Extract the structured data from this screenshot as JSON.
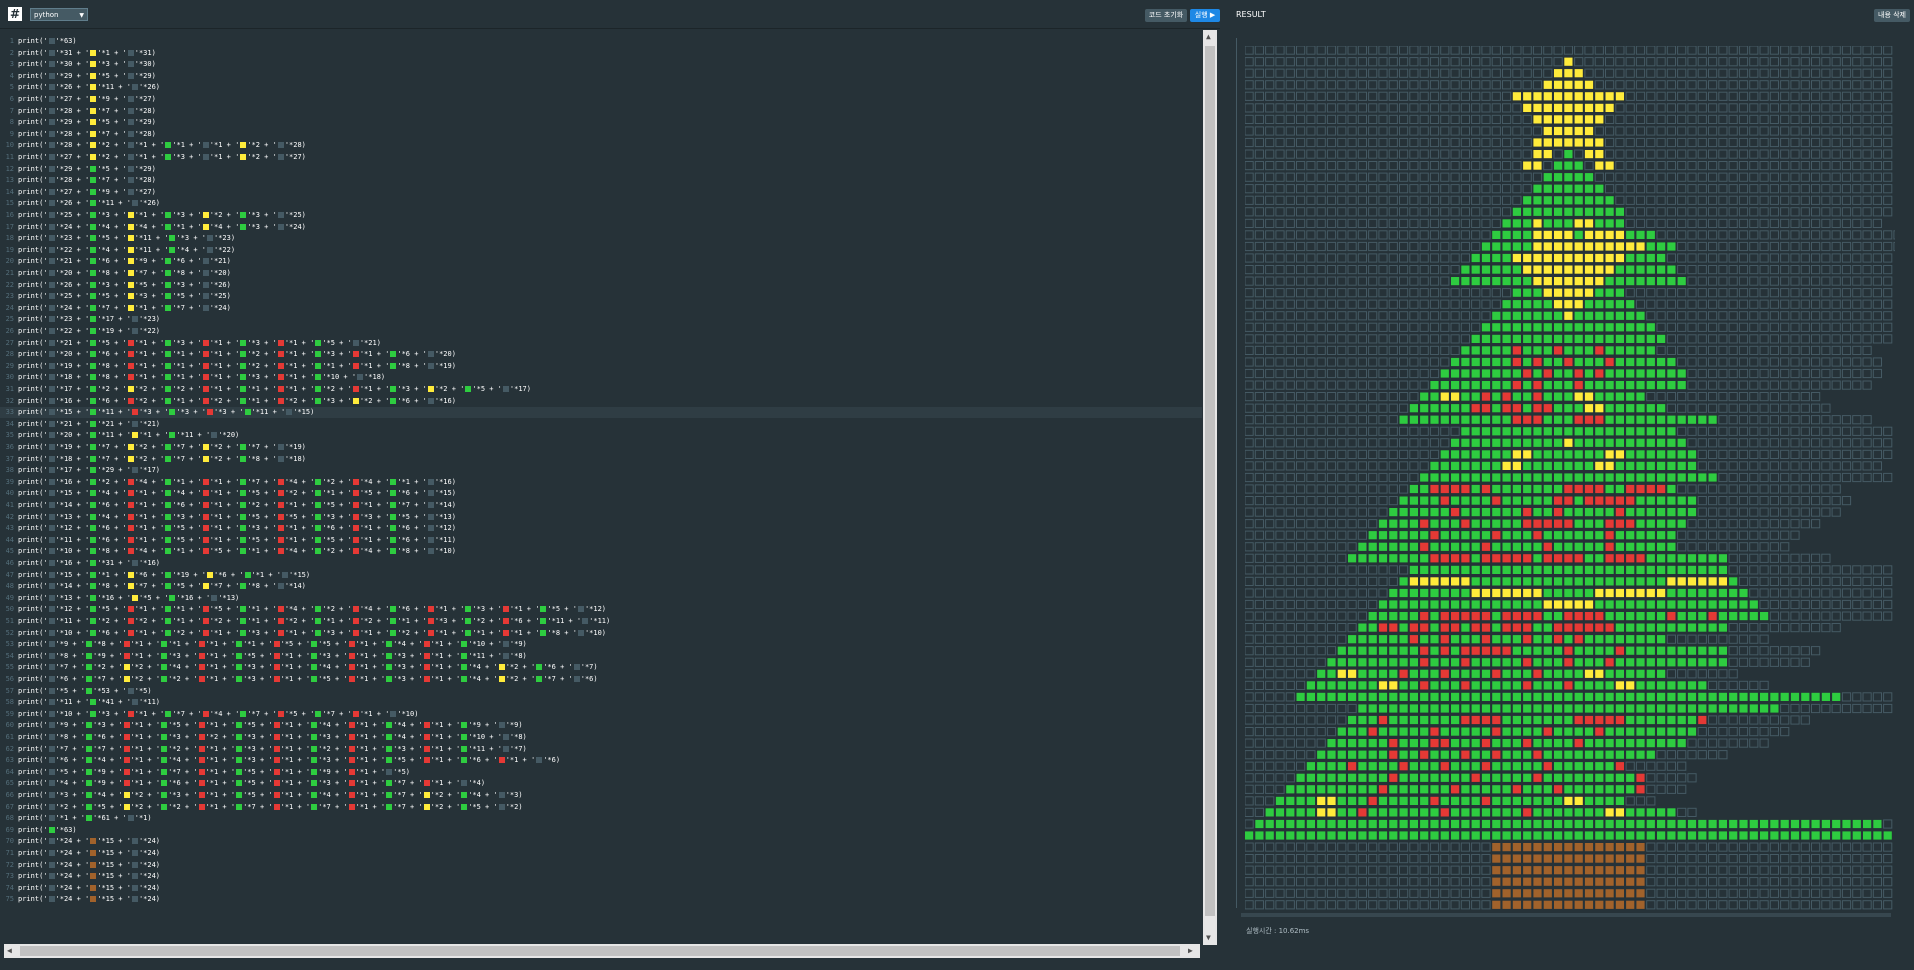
{
  "toolbar": {
    "logo_icon": "#",
    "language": "python",
    "reset_label": "코드 초기화",
    "run_label": "실행 ▶"
  },
  "result": {
    "title": "RESULT",
    "clear_label": "내용 삭제",
    "exec_time": "실행시간 : 10.62ms"
  },
  "colors": {
    "black": "#455a64",
    "yellow": "#ffeb3b",
    "green": "#2ecc40",
    "red": "#e53935",
    "brown": "#a1622b"
  },
  "code_lines": [
    "print('⬛'*63)",
    "print('⬛'*31 + '🟨'*1 + '⬛'*31)",
    "print('⬛'*30 + '🟨'*3 + '⬛'*30)",
    "print('⬛'*29 + '🟨'*5 + '⬛'*29)",
    "print('⬛'*26 + '🟨'*11 + '⬛'*26)",
    "print('⬛'*27 + '🟨'*9 + '⬛'*27)",
    "print('⬛'*28 + '🟨'*7 + '⬛'*28)",
    "print('⬛'*29 + '🟨'*5 + '⬛'*29)",
    "print('⬛'*28 + '🟨'*7 + '⬛'*28)",
    "print('⬛'*28 + '🟨'*2 + '⬛'*1 + '🟩'*1 + '⬛'*1 + '🟨'*2 + '⬛'*28)",
    "print('⬛'*27 + '🟨'*2 + '⬛'*1 + '🟩'*3 + '⬛'*1 + '🟨'*2 + '⬛'*27)",
    "print('⬛'*29 + '🟩'*5 + '⬛'*29)",
    "print('⬛'*28 + '🟩'*7 + '⬛'*28)",
    "print('⬛'*27 + '🟩'*9 + '⬛'*27)",
    "print('⬛'*26 + '🟩'*11 + '⬛'*26)",
    "print('⬛'*25 + '🟩'*3 + '🟨'*1 + '🟩'*3 + '🟨'*2 + '🟩'*3 + '⬛'*25)",
    "print('⬛'*24 + '🟩'*4 + '🟨'*4 + '🟩'*1 + '🟨'*4 + '🟩'*3 + '⬛'*24)",
    "print('⬛'*23 + '🟩'*5 + '🟨'*11 + '🟩'*3 + '⬛'*23)",
    "print('⬛'*22 + '🟩'*4 + '🟨'*11 + '🟩'*4 + '⬛'*22)",
    "print('⬛'*21 + '🟩'*6 + '🟨'*9 + '🟩'*6 + '⬛'*21)",
    "print('⬛'*20 + '🟩'*8 + '🟨'*7 + '🟩'*8 + '⬛'*20)",
    "print('⬛'*26 + '🟩'*3 + '🟨'*5 + '🟩'*3 + '⬛'*26)",
    "print('⬛'*25 + '🟩'*5 + '🟨'*3 + '🟩'*5 + '⬛'*25)",
    "print('⬛'*24 + '🟩'*7 + '🟨'*1 + '🟩'*7 + '⬛'*24)",
    "print('⬛'*23 + '🟩'*17 + '⬛'*23)",
    "print('⬛'*22 + '🟩'*19 + '⬛'*22)",
    "print('⬛'*21 + '🟩'*5 + '🟥'*1 + '🟩'*3 + '🟥'*1 + '🟩'*3 + '🟥'*1 + '🟩'*5 + '⬛'*21)",
    "print('⬛'*20 + '🟩'*6 + '🟥'*1 + '🟩'*1 + '🟥'*1 + '🟩'*2 + '🟥'*1 + '🟩'*3 + '🟥'*1 + '🟩'*6 + '⬛'*20)",
    "print('⬛'*19 + '🟩'*8 + '🟥'*1 + '🟩'*1 + '🟥'*1 + '🟩'*2 + '🟥'*1 + '🟩'*1 + '🟥'*1 + '🟩'*8 + '⬛'*19)",
    "print('⬛'*18 + '🟩'*8 + '🟥'*1 + '🟩'*1 + '🟥'*1 + '🟩'*3 + '🟥'*1 + '🟩'*10 + '⬛'*18)",
    "print('⬛'*17 + '🟩'*2 + '🟨'*2 + '🟩'*2 + '🟥'*1 + '🟩'*1 + '🟥'*1 + '🟩'*2 + '🟥'*1 + '🟩'*3 + '🟨'*2 + '🟩'*5 + '⬛'*17)",
    "print('⬛'*16 + '🟩'*6 + '🟥'*2 + '🟩'*1 + '🟥'*2 + '🟩'*1 + '🟥'*2 + '🟩'*3 + '🟨'*2 + '🟩'*6 + '⬛'*16)",
    "print('⬛'*15 + '🟩'*11 + '🟥'*3 + '🟩'*3 + '🟥'*3 + '🟩'*11 + '⬛'*15)",
    "print('⬛'*21 + '🟩'*21 + '⬛'*21)",
    "print('⬛'*20 + '🟩'*11 + '🟨'*1 + '🟩'*11 + '⬛'*20)",
    "print('⬛'*19 + '🟩'*7 + '🟨'*2 + '🟩'*7 + '🟨'*2 + '🟩'*7 + '⬛'*19)",
    "print('⬛'*18 + '🟩'*7 + '🟨'*2 + '🟩'*7 + '🟨'*2 + '🟩'*8 + '⬛'*18)",
    "print('⬛'*17 + '🟩'*29 + '⬛'*17)",
    "print('⬛'*16 + '🟩'*2 + '🟥'*4 + '🟩'*1 + '🟥'*1 + '🟩'*7 + '🟥'*4 + '🟩'*2 + '🟥'*4 + '🟩'*1 + '⬛'*16)",
    "print('⬛'*15 + '🟩'*4 + '🟥'*1 + '🟩'*4 + '🟥'*1 + '🟩'*5 + '🟥'*2 + '🟩'*1 + '🟥'*5 + '🟩'*6 + '⬛'*15)",
    "print('⬛'*14 + '🟩'*6 + '🟥'*1 + '🟩'*6 + '🟥'*1 + '🟩'*2 + '🟥'*1 + '🟩'*5 + '🟥'*1 + '🟩'*7 + '⬛'*14)",
    "print('⬛'*13 + '🟩'*4 + '🟥'*1 + '🟩'*3 + '🟥'*1 + '🟩'*5 + '🟥'*5 + '🟩'*3 + '🟥'*3 + '🟩'*5 + '⬛'*13)",
    "print('⬛'*12 + '🟩'*6 + '🟥'*1 + '🟩'*5 + '🟥'*1 + '🟩'*3 + '🟥'*1 + '🟩'*6 + '🟥'*1 + '🟩'*6 + '⬛'*12)",
    "print('⬛'*11 + '🟩'*6 + '🟥'*1 + '🟩'*5 + '🟥'*1 + '🟩'*5 + '🟥'*1 + '🟩'*5 + '🟥'*1 + '🟩'*6 + '⬛'*11)",
    "print('⬛'*10 + '🟩'*8 + '🟥'*4 + '🟩'*1 + '🟥'*5 + '🟩'*1 + '🟥'*4 + '🟩'*2 + '🟥'*4 + '🟩'*8 + '⬛'*10)",
    "print('⬛'*16 + '🟩'*31 + '⬛'*16)",
    "print('⬛'*15 + '🟩'*1 + '🟨'*6 + '🟩'*19 + '🟨'*6 + '🟩'*1 + '⬛'*15)",
    "print('⬛'*14 + '🟩'*8 + '🟨'*7 + '🟩'*5 + '🟨'*7 + '🟩'*8 + '⬛'*14)",
    "print('⬛'*13 + '🟩'*16 + '🟨'*5 + '🟩'*16 + '⬛'*13)",
    "print('⬛'*12 + '🟩'*5 + '🟥'*1 + '🟩'*1 + '🟥'*5 + '🟩'*1 + '🟥'*4 + '🟩'*2 + '🟥'*4 + '🟩'*6 + '🟥'*1 + '🟩'*3 + '🟥'*1 + '🟩'*5 + '⬛'*12)",
    "print('⬛'*11 + '🟩'*2 + '🟥'*2 + '🟩'*1 + '🟥'*2 + '🟩'*1 + '🟥'*2 + '🟩'*1 + '🟥'*2 + '🟩'*1 + '🟥'*3 + '🟩'*2 + '🟥'*6 + '🟩'*11 + '⬛'*11)",
    "print('⬛'*10 + '🟩'*6 + '🟥'*1 + '🟩'*2 + '🟥'*1 + '🟩'*3 + '🟥'*1 + '🟩'*3 + '🟥'*1 + '🟩'*2 + '🟥'*1 + '🟩'*1 + '🟥'*1 + '🟩'*8 + '⬛'*10)",
    "print('⬛'*9 + '🟩'*8 + '🟥'*1 + '🟩'*1 + '🟥'*1 + '🟩'*1 + '🟥'*5 + '🟩'*5 + '🟥'*1 + '🟩'*4 + '🟥'*1 + '🟩'*10 + '⬛'*9)",
    "print('⬛'*8 + '🟩'*9 + '🟥'*1 + '🟩'*3 + '🟥'*1 + '🟩'*5 + '🟥'*1 + '🟩'*3 + '🟥'*1 + '🟩'*3 + '🟥'*1 + '🟩'*11 + '⬛'*8)",
    "print('⬛'*7 + '🟩'*2 + '🟨'*2 + '🟩'*4 + '🟥'*1 + '🟩'*3 + '🟥'*1 + '🟩'*4 + '🟥'*1 + '🟩'*3 + '🟥'*1 + '🟩'*4 + '🟨'*2 + '🟩'*6 + '⬛'*7)",
    "print('⬛'*6 + '🟩'*7 + '🟨'*2 + '🟩'*2 + '🟥'*1 + '🟩'*3 + '🟥'*1 + '🟩'*5 + '🟥'*1 + '🟩'*3 + '🟥'*1 + '🟩'*4 + '🟨'*2 + '🟩'*7 + '⬛'*6)",
    "print('⬛'*5 + '🟩'*53 + '⬛'*5)",
    "print('⬛'*11 + '🟩'*41 + '⬛'*11)",
    "print('⬛'*10 + '🟩'*3 + '🟥'*1 + '🟩'*7 + '🟥'*4 + '🟩'*7 + '🟥'*5 + '🟩'*7 + '🟥'*1 + '⬛'*10)",
    "print('⬛'*9 + '🟩'*3 + '🟥'*1 + '🟩'*5 + '🟥'*1 + '🟩'*5 + '🟥'*1 + '🟩'*4 + '🟥'*1 + '🟩'*4 + '🟥'*1 + '🟩'*9 + '⬛'*9)",
    "print('⬛'*8 + '🟩'*6 + '🟥'*1 + '🟩'*3 + '🟥'*2 + '🟩'*3 + '🟥'*1 + '🟩'*3 + '🟥'*1 + '🟩'*4 + '🟥'*1 + '🟩'*10 + '⬛'*8)",
    "print('⬛'*7 + '🟩'*7 + '🟥'*1 + '🟩'*2 + '🟥'*1 + '🟩'*3 + '🟥'*1 + '🟩'*2 + '🟥'*1 + '🟩'*3 + '🟥'*1 + '🟩'*11 + '⬛'*7)",
    "print('⬛'*6 + '🟩'*4 + '🟥'*1 + '🟩'*4 + '🟥'*1 + '🟩'*3 + '🟥'*1 + '🟩'*3 + '🟥'*1 + '🟩'*5 + '🟥'*1 + '🟩'*6 + '🟥'*1 + '⬛'*6)",
    "print('⬛'*5 + '🟩'*9 + '🟥'*1 + '🟩'*7 + '🟥'*1 + '🟩'*5 + '🟥'*1 + '🟩'*9 + '🟥'*1 + '⬛'*5)",
    "print('⬛'*4 + '🟩'*9 + '🟥'*1 + '🟩'*6 + '🟥'*1 + '🟩'*5 + '🟥'*1 + '🟩'*3 + '🟥'*1 + '🟩'*7 + '🟥'*1 + '⬛'*4)",
    "print('⬛'*3 + '🟩'*4 + '🟨'*2 + '🟩'*3 + '🟥'*1 + '🟩'*5 + '🟥'*1 + '🟩'*4 + '🟥'*1 + '🟩'*7 + '🟨'*2 + '🟩'*4 + '⬛'*3)",
    "print('⬛'*2 + '🟩'*5 + '🟨'*2 + '🟩'*2 + '🟥'*1 + '🟩'*7 + '🟥'*1 + '🟩'*7 + '🟥'*1 + '🟩'*7 + '🟨'*2 + '🟩'*5 + '⬛'*2)",
    "print('⬛'*1 + '🟩'*61 + '⬛'*1)",
    "print('🟩'*63)",
    "print('⬛'*24 + '🟫'*15 + '⬛'*24)",
    "print('⬛'*24 + '🟫'*15 + '⬛'*24)",
    "print('⬛'*24 + '🟫'*15 + '⬛'*24)",
    "print('⬛'*24 + '🟫'*15 + '⬛'*24)",
    "print('⬛'*24 + '🟫'*15 + '⬛'*24)",
    "print('⬛'*24 + '🟫'*15 + '⬛'*24)"
  ]
}
